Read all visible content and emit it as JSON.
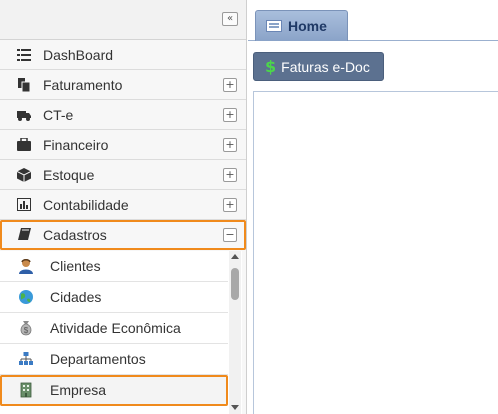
{
  "sidebar": {
    "collapse_glyph": "«",
    "items": [
      {
        "label": "DashBoard",
        "icon": "list-icon",
        "toggle": ""
      },
      {
        "label": "Faturamento",
        "icon": "documents-icon",
        "toggle": "+"
      },
      {
        "label": "CT-e",
        "icon": "truck-icon",
        "toggle": "+"
      },
      {
        "label": "Financeiro",
        "icon": "briefcase-icon",
        "toggle": "+"
      },
      {
        "label": "Estoque",
        "icon": "box-icon",
        "toggle": "+"
      },
      {
        "label": "Contabilidade",
        "icon": "bar-chart-icon",
        "toggle": "+"
      },
      {
        "label": "Cadastros",
        "icon": "book-icon",
        "toggle": "−"
      }
    ],
    "submenu": [
      {
        "label": "Clientes",
        "icon": "user-icon"
      },
      {
        "label": "Cidades",
        "icon": "globe-icon"
      },
      {
        "label": "Atividade Econômica",
        "icon": "money-bag-icon"
      },
      {
        "label": "Departamentos",
        "icon": "org-chart-icon"
      },
      {
        "label": "Empresa",
        "icon": "building-icon"
      }
    ]
  },
  "tabs": [
    {
      "label": "Home",
      "icon": "home-tab-icon"
    }
  ],
  "toolbar": {
    "faturas_label": "Faturas e-Doc",
    "faturas_icon": "dollar-icon",
    "dollar_glyph": "$"
  },
  "colors": {
    "highlight": "#f08a1c",
    "tab": "#8aa3c8",
    "button": "#5c7190",
    "dollar": "#4cd64a"
  }
}
